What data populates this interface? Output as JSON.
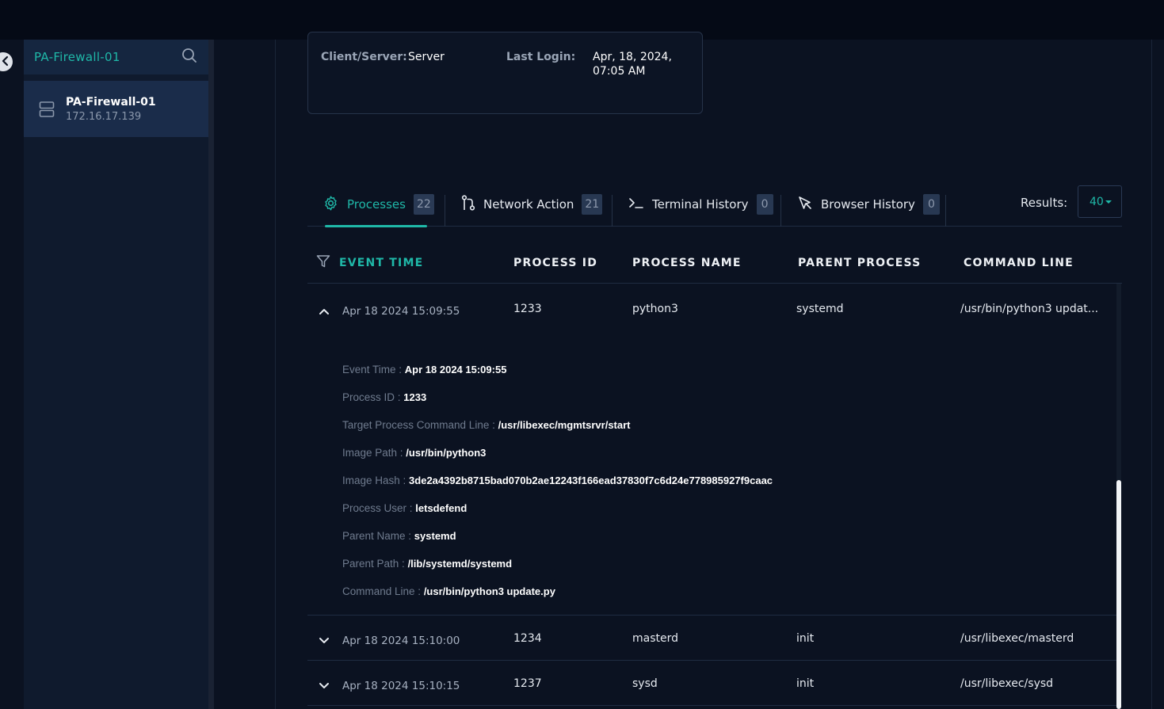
{
  "sidebar": {
    "search_value": "PA-Firewall-01",
    "device": {
      "name": "PA-Firewall-01",
      "ip": "172.16.17.139",
      "icon": "server-icon"
    }
  },
  "info": {
    "client_server_label": "Client/Server:",
    "client_server_value": "Server",
    "last_login_label": "Last Login:",
    "last_login_value_line1": "Apr, 18, 2024,",
    "last_login_value_line2": "07:05 AM"
  },
  "tabs": [
    {
      "label": "Processes",
      "count": "22",
      "icon": "gear-icon",
      "active": true
    },
    {
      "label": "Network Action",
      "count": "21",
      "icon": "network-icon",
      "active": false
    },
    {
      "label": "Terminal History",
      "count": "0",
      "icon": "terminal-icon",
      "active": false
    },
    {
      "label": "Browser History",
      "count": "0",
      "icon": "cursor-icon",
      "active": false
    }
  ],
  "results": {
    "label": "Results:",
    "value": "40"
  },
  "columns": {
    "event_time": "EVENT TIME",
    "process_id": "PROCESS ID",
    "process_name": "PROCESS NAME",
    "parent_process": "PARENT PROCESS",
    "command_line": "COMMAND LINE"
  },
  "rows": [
    {
      "time": "Apr 18 2024 15:09:55",
      "pid": "1233",
      "name": "python3",
      "parent": "systemd",
      "cmd": "/usr/bin/python3 updat...",
      "expanded": true
    },
    {
      "time": "Apr 18 2024 15:10:00",
      "pid": "1234",
      "name": "masterd",
      "parent": "init",
      "cmd": "/usr/libexec/masterd",
      "expanded": false
    },
    {
      "time": "Apr 18 2024 15:10:15",
      "pid": "1237",
      "name": "sysd",
      "parent": "init",
      "cmd": "/usr/libexec/sysd",
      "expanded": false
    }
  ],
  "details": [
    {
      "key": "Event Time : ",
      "value": "Apr 18 2024 15:09:55"
    },
    {
      "key": "Process ID : ",
      "value": "1233"
    },
    {
      "key": "Target Process Command Line : ",
      "value": "/usr/libexec/mgmtsrvr/start"
    },
    {
      "key": "Image Path : ",
      "value": "/usr/bin/python3"
    },
    {
      "key": "Image Hash : ",
      "value": "3de2a4392b8715bad070b2ae12243f166ead37830f7c6d24e778985927f9caac"
    },
    {
      "key": "Process User : ",
      "value": "letsdefend"
    },
    {
      "key": "Parent Name : ",
      "value": "systemd"
    },
    {
      "key": "Parent Path : ",
      "value": "/lib/systemd/systemd"
    },
    {
      "key": "Command Line : ",
      "value": "/usr/bin/python3 update.py"
    }
  ],
  "colors": {
    "accent": "#1fb8a8",
    "background": "#0b1221",
    "sidebar": "#0f1a2d"
  }
}
